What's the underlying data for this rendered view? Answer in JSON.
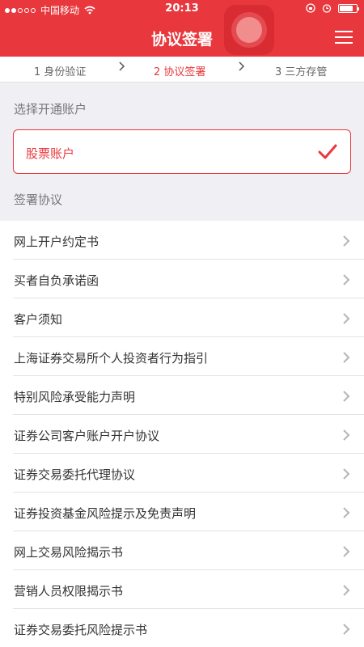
{
  "status_bar": {
    "carrier": "中国移动",
    "time": "20:13",
    "battery_level": 0.8
  },
  "header": {
    "title": "协议签署",
    "menu_icon": "hamburger-icon",
    "record_icon": "record-icon"
  },
  "steps": [
    {
      "label": "1 身份验证",
      "active": false
    },
    {
      "label": "2 协议签署",
      "active": true
    },
    {
      "label": "3 三方存管",
      "active": false
    }
  ],
  "account_section": {
    "title": "选择开通账户",
    "selected_account": "股票账户",
    "check_icon": "checkmark-icon"
  },
  "agreement_section": {
    "title": "签署协议",
    "items": [
      "网上开户约定书",
      "买者自负承诺函",
      "客户须知",
      "上海证券交易所个人投资者行为指引",
      "特别风险承受能力声明",
      "证券公司客户账户开户协议",
      "证券交易委托代理协议",
      "证券投资基金风险提示及免责声明",
      "网上交易风险揭示书",
      "营销人员权限揭示书",
      "证券交易委托风险提示书"
    ]
  },
  "colors": {
    "accent": "#e8383d",
    "background": "#f0eff4"
  }
}
